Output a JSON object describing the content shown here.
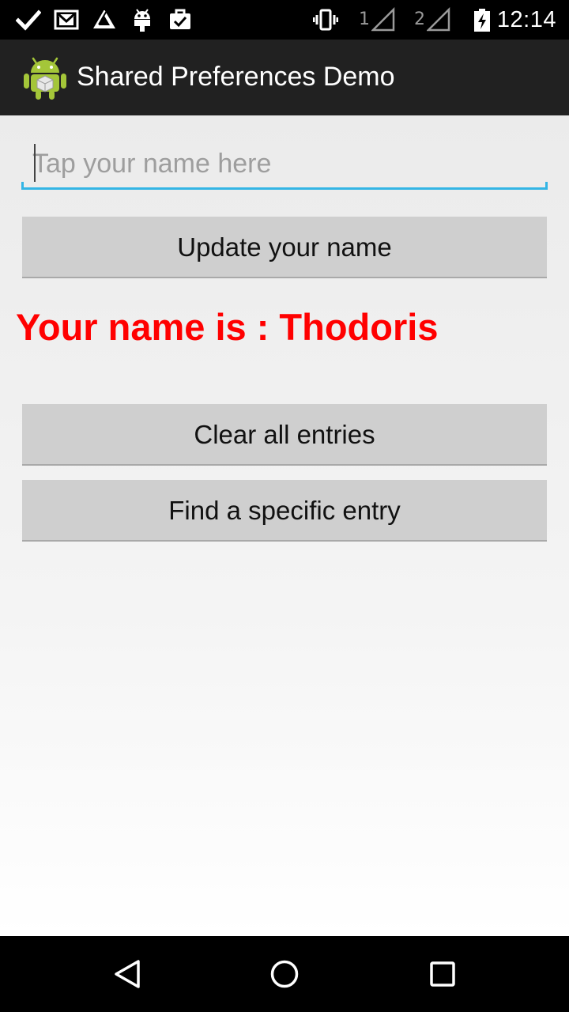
{
  "status_bar": {
    "notification_icons": [
      "check-icon",
      "gmail-icon",
      "drive-icon",
      "android-debug-icon",
      "clipboard-icon"
    ],
    "system_icons": [
      "vibrate-icon",
      "signal-sim1-icon",
      "signal-sim2-icon",
      "battery-charging-icon"
    ],
    "sim1_label": "1",
    "sim2_label": "2",
    "time": "12:14"
  },
  "action_bar": {
    "icon": "android-app-icon",
    "title": "Shared Preferences Demo"
  },
  "form": {
    "name_value": "",
    "name_placeholder": "Tap your name here",
    "update_button_label": "Update your name"
  },
  "result": {
    "name_text": "Your name is : Thodoris"
  },
  "actions": {
    "clear_button_label": "Clear all entries",
    "find_button_label": "Find a specific entry"
  },
  "nav_bar": {
    "buttons": [
      "back-icon",
      "home-icon",
      "recent-apps-icon"
    ]
  },
  "colors": {
    "status_bar_bg": "#000000",
    "action_bar_bg": "#212121",
    "input_underline": "#33b5e5",
    "button_bg": "#cfcfcf",
    "name_text_color": "#ff0000"
  }
}
